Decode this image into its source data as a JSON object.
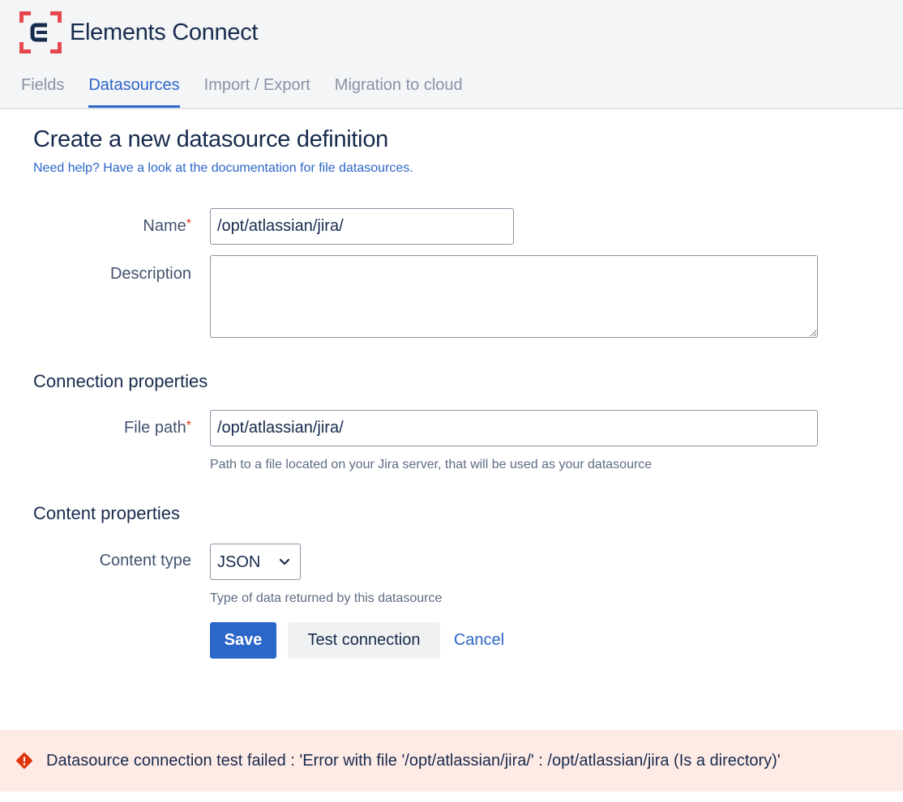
{
  "app": {
    "title": "Elements Connect",
    "logo_icon": "elements-connect-logo-icon",
    "brand_color": "#e5484d"
  },
  "tabs": [
    {
      "label": "Fields",
      "active": false
    },
    {
      "label": "Datasources",
      "active": true
    },
    {
      "label": "Import / Export",
      "active": false
    },
    {
      "label": "Migration to cloud",
      "active": false
    }
  ],
  "page": {
    "title": "Create a new datasource definition",
    "help_link": "Need help? Have a look at the documentation for file datasources."
  },
  "form": {
    "name": {
      "label": "Name",
      "required_mark": "*",
      "value": "/opt/atlassian/jira/"
    },
    "description": {
      "label": "Description",
      "value": ""
    },
    "connection_section": "Connection properties",
    "file_path": {
      "label": "File path",
      "required_mark": "*",
      "value": "/opt/atlassian/jira/",
      "helper": "Path to a file located on your Jira server, that will be used as your datasource"
    },
    "content_section": "Content properties",
    "content_type": {
      "label": "Content type",
      "value": "JSON",
      "helper": "Type of data returned by this datasource"
    }
  },
  "actions": {
    "save": "Save",
    "test": "Test connection",
    "cancel": "Cancel"
  },
  "error": {
    "icon": "error-icon",
    "message": "Datasource connection test failed : 'Error with file '/opt/atlassian/jira/' : /opt/atlassian/jira (Is a directory)'"
  },
  "colors": {
    "accent": "#2b66c9",
    "error_bg": "#ffebe6",
    "error_icon": "#de350b",
    "required": "#de350b"
  }
}
